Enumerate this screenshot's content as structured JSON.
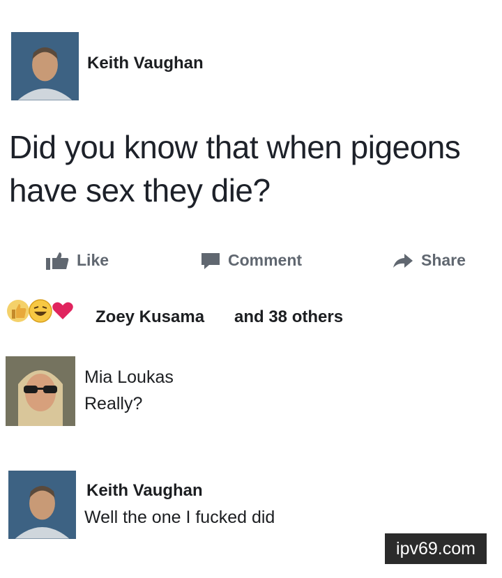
{
  "post": {
    "author": "Keith Vaughan",
    "text": "Did you know that when pigeons have sex they die?"
  },
  "actions": {
    "like": "Like",
    "comment": "Comment",
    "share": "Share"
  },
  "reactions": {
    "icons": [
      "like-icon",
      "haha-icon",
      "love-icon"
    ],
    "name": "Zoey Kusama",
    "others": "and 38 others"
  },
  "comments": [
    {
      "author": "Mia Loukas",
      "text": "Really?"
    },
    {
      "author": "Keith Vaughan",
      "text": "Well the one I fucked did"
    }
  ],
  "watermark": "ipv69.com",
  "colors": {
    "text": "#1c1e21",
    "action_gray": "#606770",
    "love": "#e0245e",
    "haha": "#f7c843"
  }
}
